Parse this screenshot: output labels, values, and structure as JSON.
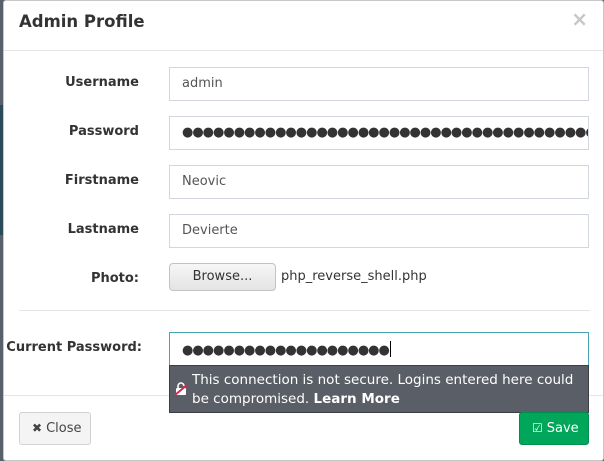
{
  "modal": {
    "title": "Admin Profile",
    "close_glyph": "×"
  },
  "form": {
    "username": {
      "label": "Username",
      "value": "admin"
    },
    "password": {
      "label": "Password",
      "value": "●●●●●●●●●●●●●●●●●●●●●●●●●●●●●●●●●●●●●●●●●●●●●●●●●●●●●●●"
    },
    "firstname": {
      "label": "Firstname",
      "value": "Neovic"
    },
    "lastname": {
      "label": "Lastname",
      "value": "Devierte"
    },
    "photo": {
      "label": "Photo:",
      "browse_label": "Browse...",
      "file_name": "php_reverse_shell.php"
    },
    "current_password": {
      "label": "Current Password:",
      "value": "●●●●●●●●●●●●●●●●●●●●"
    }
  },
  "security_tooltip": {
    "message": "This connection is not secure. Logins entered here could be compromised.",
    "link_label": "Learn More",
    "icon": "insecure-lock-icon"
  },
  "footer": {
    "close_label": "Close",
    "close_icon": "times-icon",
    "save_label": "Save",
    "save_icon": "check-square-icon"
  },
  "colors": {
    "save_green": "#00a65a",
    "tooltip_bg": "#5a5e66",
    "focus_border": "#48a5b6"
  }
}
